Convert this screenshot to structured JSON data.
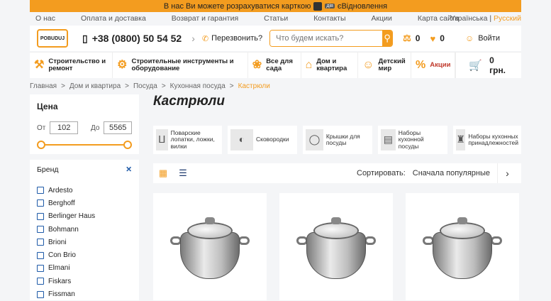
{
  "banner": {
    "text": "В нас Ви можете розрахуватися карткою",
    "suffix": "єВідновлення",
    "badge": "дія"
  },
  "topnav": {
    "links": [
      "О нас",
      "Оплата и доставка",
      "Возврат и гарантия",
      "Статьи",
      "Контакты",
      "Акции",
      "Карта сайта"
    ]
  },
  "lang": {
    "ua": "Українська",
    "sep": "|",
    "ru": "Русский"
  },
  "header": {
    "logo": "POBUDUJ",
    "phone": "+38 (0800) 50 54 52",
    "callback": "Перезвонить?",
    "search_placeholder": "Что будем искать?",
    "compare_count": "0",
    "wishlist_count": "0",
    "login": "Войти"
  },
  "categories": [
    {
      "label": "Строительство и ремонт",
      "icon": "hammer-icon",
      "glyph": "⚒"
    },
    {
      "label": "Строительные инструменты и оборудование",
      "icon": "drill-icon",
      "glyph": "⚙"
    },
    {
      "label": "Все для сада",
      "icon": "garden-icon",
      "glyph": "❀"
    },
    {
      "label": "Дом и квартира",
      "icon": "sofa-icon",
      "glyph": "⌂"
    },
    {
      "label": "Детский мир",
      "icon": "baby-icon",
      "glyph": "☺"
    },
    {
      "label": "Акции",
      "icon": "percent-icon",
      "glyph": "%"
    }
  ],
  "cart": {
    "total": "0 грн."
  },
  "breadcrumb": [
    "Главная",
    "Дом и квартира",
    "Посуда",
    "Кухонная посуда",
    "Кастрюли"
  ],
  "breadcrumb_sep": ">",
  "filter": {
    "title": "Цена",
    "from_label": "От",
    "from_value": "102",
    "to_label": "До",
    "to_value": "5565",
    "min_pos": 0,
    "max_pos": 1
  },
  "brands": {
    "title": "Бренд",
    "clear": "✕",
    "items": [
      "Ardesto",
      "Berghoff",
      "Berlinger Haus",
      "Bohmann",
      "Brioni",
      "Con Brio",
      "Elmani",
      "Fiskars",
      "Fissman"
    ]
  },
  "page_title": "Кастрюли",
  "subcategories": [
    {
      "label": "Поварские лопатки, ложки, вилки",
      "icon": "utensils-icon",
      "glyph": "🥄"
    },
    {
      "label": "Сковородки",
      "icon": "pan-icon",
      "glyph": "◐"
    },
    {
      "label": "Крышки для посуды",
      "icon": "lid-icon",
      "glyph": "◯"
    },
    {
      "label": "Наборы кухонной посуды",
      "icon": "pots-set-icon",
      "glyph": "▤"
    },
    {
      "label": "Наборы кухонных принадлежностей",
      "icon": "tools-set-icon",
      "glyph": "♜"
    }
  ],
  "toolbar": {
    "sort_label": "Сортировать:",
    "sort_value": "Сначала популярные",
    "next": "›"
  },
  "products": [
    {
      "name": "Кастрюля"
    },
    {
      "name": "Кастрюля"
    },
    {
      "name": "Кастрюля"
    }
  ],
  "colors": {
    "accent": "#f39c1f",
    "link": "#1e5aa8"
  }
}
